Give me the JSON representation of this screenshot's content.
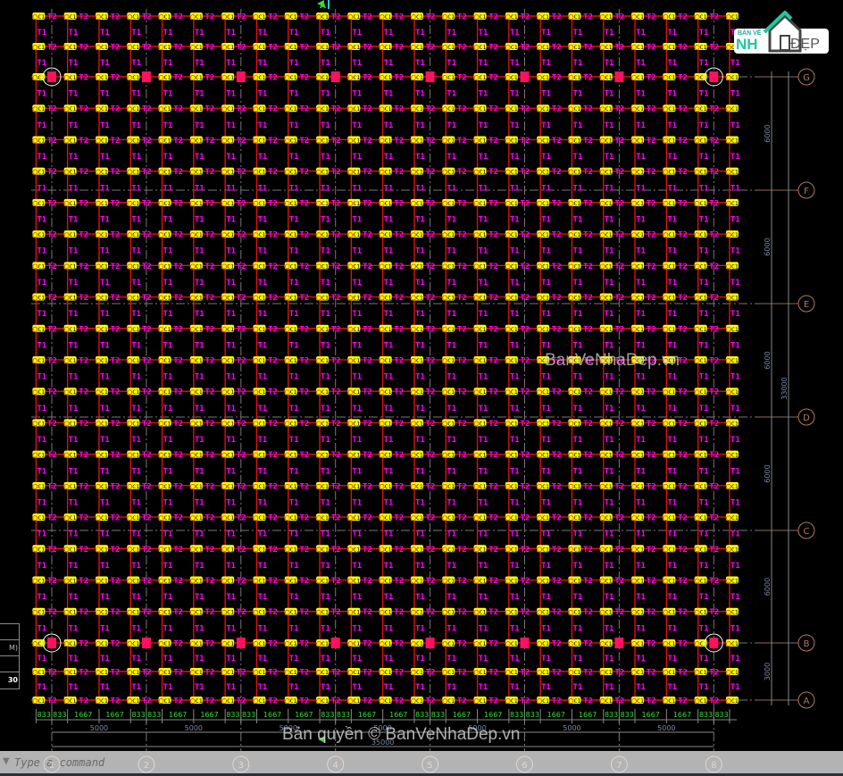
{
  "drawing": {
    "vertical_axes": [
      "1",
      "2",
      "3",
      "4",
      "5",
      "6",
      "7",
      "8"
    ],
    "horizontal_axes": [
      "G",
      "F",
      "E",
      "D",
      "C",
      "B",
      "A"
    ],
    "right_dims": [
      "6000",
      "6000",
      "6000",
      "6000",
      "6000",
      "3000"
    ],
    "right_total": "33000",
    "bottom_segments": [
      "833",
      "833",
      "1667",
      "1667",
      "833",
      "833",
      "1667",
      "1667",
      "833",
      "833",
      "1667",
      "1667",
      "833",
      "833",
      "1667",
      "1667",
      "833",
      "833",
      "1667",
      "1667",
      "833",
      "833",
      "1667",
      "1667",
      "833",
      "833",
      "1667",
      "1667",
      "833",
      "833"
    ],
    "bottom_bays": [
      "5000",
      "5000",
      "5000",
      "5000",
      "5000",
      "5000",
      "5000"
    ],
    "bottom_total": "35000",
    "column_tag": "C1",
    "vertical_beam_tag": "T1",
    "horizontal_beam_tag": "T2",
    "section_marker": "A",
    "colors": {
      "grid": "#e01010",
      "column": "#ffff00",
      "beam_tag": "#ff00ff",
      "axis_bubble": "#b07a60",
      "dim_green": "#33dd33",
      "dim_gray": "#7a8aa6",
      "highlight": "#ff1060"
    }
  },
  "left_table": {
    "rows": [
      "",
      "M)",
      "",
      "30"
    ]
  },
  "watermarks": {
    "center": "BanVeNhaDep.vn",
    "bottom": "Bản quyền © BanVeNhaDep.vn"
  },
  "logo": {
    "line1": "BẢN VẼ",
    "line2": "NH",
    "line3": "ĐẸP"
  },
  "command": {
    "placeholder": "Type a command"
  }
}
